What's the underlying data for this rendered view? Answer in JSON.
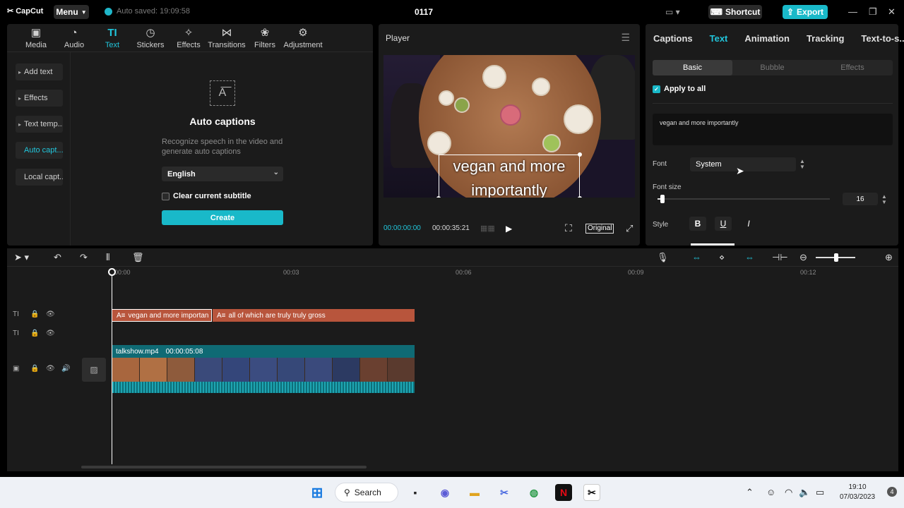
{
  "app": {
    "logo": "CapCut",
    "menu_label": "Menu",
    "autosave": "Auto saved: 19:09:58",
    "project_title": "0117",
    "shortcut_label": "Shortcut",
    "export_label": "Export"
  },
  "toolbar": [
    {
      "label": "Media",
      "icon": "media-icon"
    },
    {
      "label": "Audio",
      "icon": "audio-icon"
    },
    {
      "label": "Text",
      "icon": "text-icon"
    },
    {
      "label": "Stickers",
      "icon": "stickers-icon"
    },
    {
      "label": "Effects",
      "icon": "effects-icon"
    },
    {
      "label": "Transitions",
      "icon": "transitions-icon"
    },
    {
      "label": "Filters",
      "icon": "filters-icon"
    },
    {
      "label": "Adjustment",
      "icon": "adjustment-icon"
    }
  ],
  "sidenav": [
    "Add text",
    "Effects",
    "Text temp...",
    "Auto capt...",
    "Local capt..."
  ],
  "auto_captions": {
    "title": "Auto captions",
    "description": "Recognize speech in the video and generate auto captions",
    "language": "English",
    "clear_label": "Clear current subtitle",
    "create_label": "Create"
  },
  "player": {
    "title": "Player",
    "caption_line1": "vegan and more",
    "caption_line2": "importantly",
    "time_current": "00:00:00:00",
    "time_total": "00:00:35:21",
    "original_label": "Original"
  },
  "right_panel": {
    "tabs": [
      "Captions",
      "Text",
      "Animation",
      "Tracking",
      "Text-to-s..."
    ],
    "subtabs": [
      "Basic",
      "Bubble",
      "Effects"
    ],
    "apply_all": "Apply to all",
    "text_value": "vegan and more importantly",
    "font_label": "Font",
    "font_value": "System",
    "font_size_label": "Font size",
    "font_size_value": "16",
    "style_label": "Style",
    "style_bold": "B",
    "style_underline": "U",
    "style_italic": "I"
  },
  "timeline": {
    "ruler": [
      "00:00",
      "00:03",
      "00:06",
      "00:09",
      "00:12"
    ],
    "text_clip_1": "vegan and more importan",
    "text_clip_2": "all of which are truly truly gross",
    "video_name": "talkshow.mp4",
    "video_duration": "00:00:05:08"
  },
  "taskbar": {
    "search_label": "Search",
    "time": "19:10",
    "date": "07/03/2023",
    "notifications": "4"
  },
  "colors": {
    "accent": "#19b9c9",
    "text_clip": "#b8553c",
    "video_clip": "#0f6a74"
  }
}
